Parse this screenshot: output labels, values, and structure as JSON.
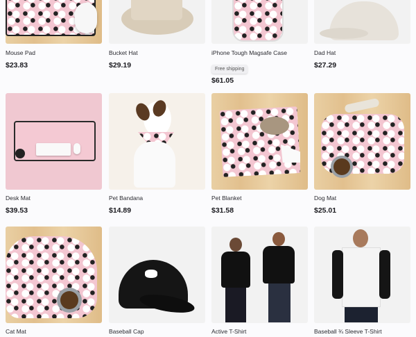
{
  "products": [
    {
      "title": "Mouse Pad",
      "price": "$23.83"
    },
    {
      "title": "Bucket Hat",
      "price": "$29.19"
    },
    {
      "title": "iPhone Tough Magsafe Case",
      "price": "$61.05",
      "badge": "Free shipping"
    },
    {
      "title": "Dad Hat",
      "price": "$27.29"
    },
    {
      "title": "Desk Mat",
      "price": "$39.53"
    },
    {
      "title": "Pet Bandana",
      "price": "$14.89"
    },
    {
      "title": "Pet Blanket",
      "price": "$31.58"
    },
    {
      "title": "Dog Mat",
      "price": "$25.01"
    },
    {
      "title": "Cat Mat",
      "price": ""
    },
    {
      "title": "Baseball Cap",
      "price": ""
    },
    {
      "title": "Active T-Shirt",
      "price": ""
    },
    {
      "title": "Baseball ¾ Sleeve T-Shirt",
      "price": ""
    }
  ]
}
